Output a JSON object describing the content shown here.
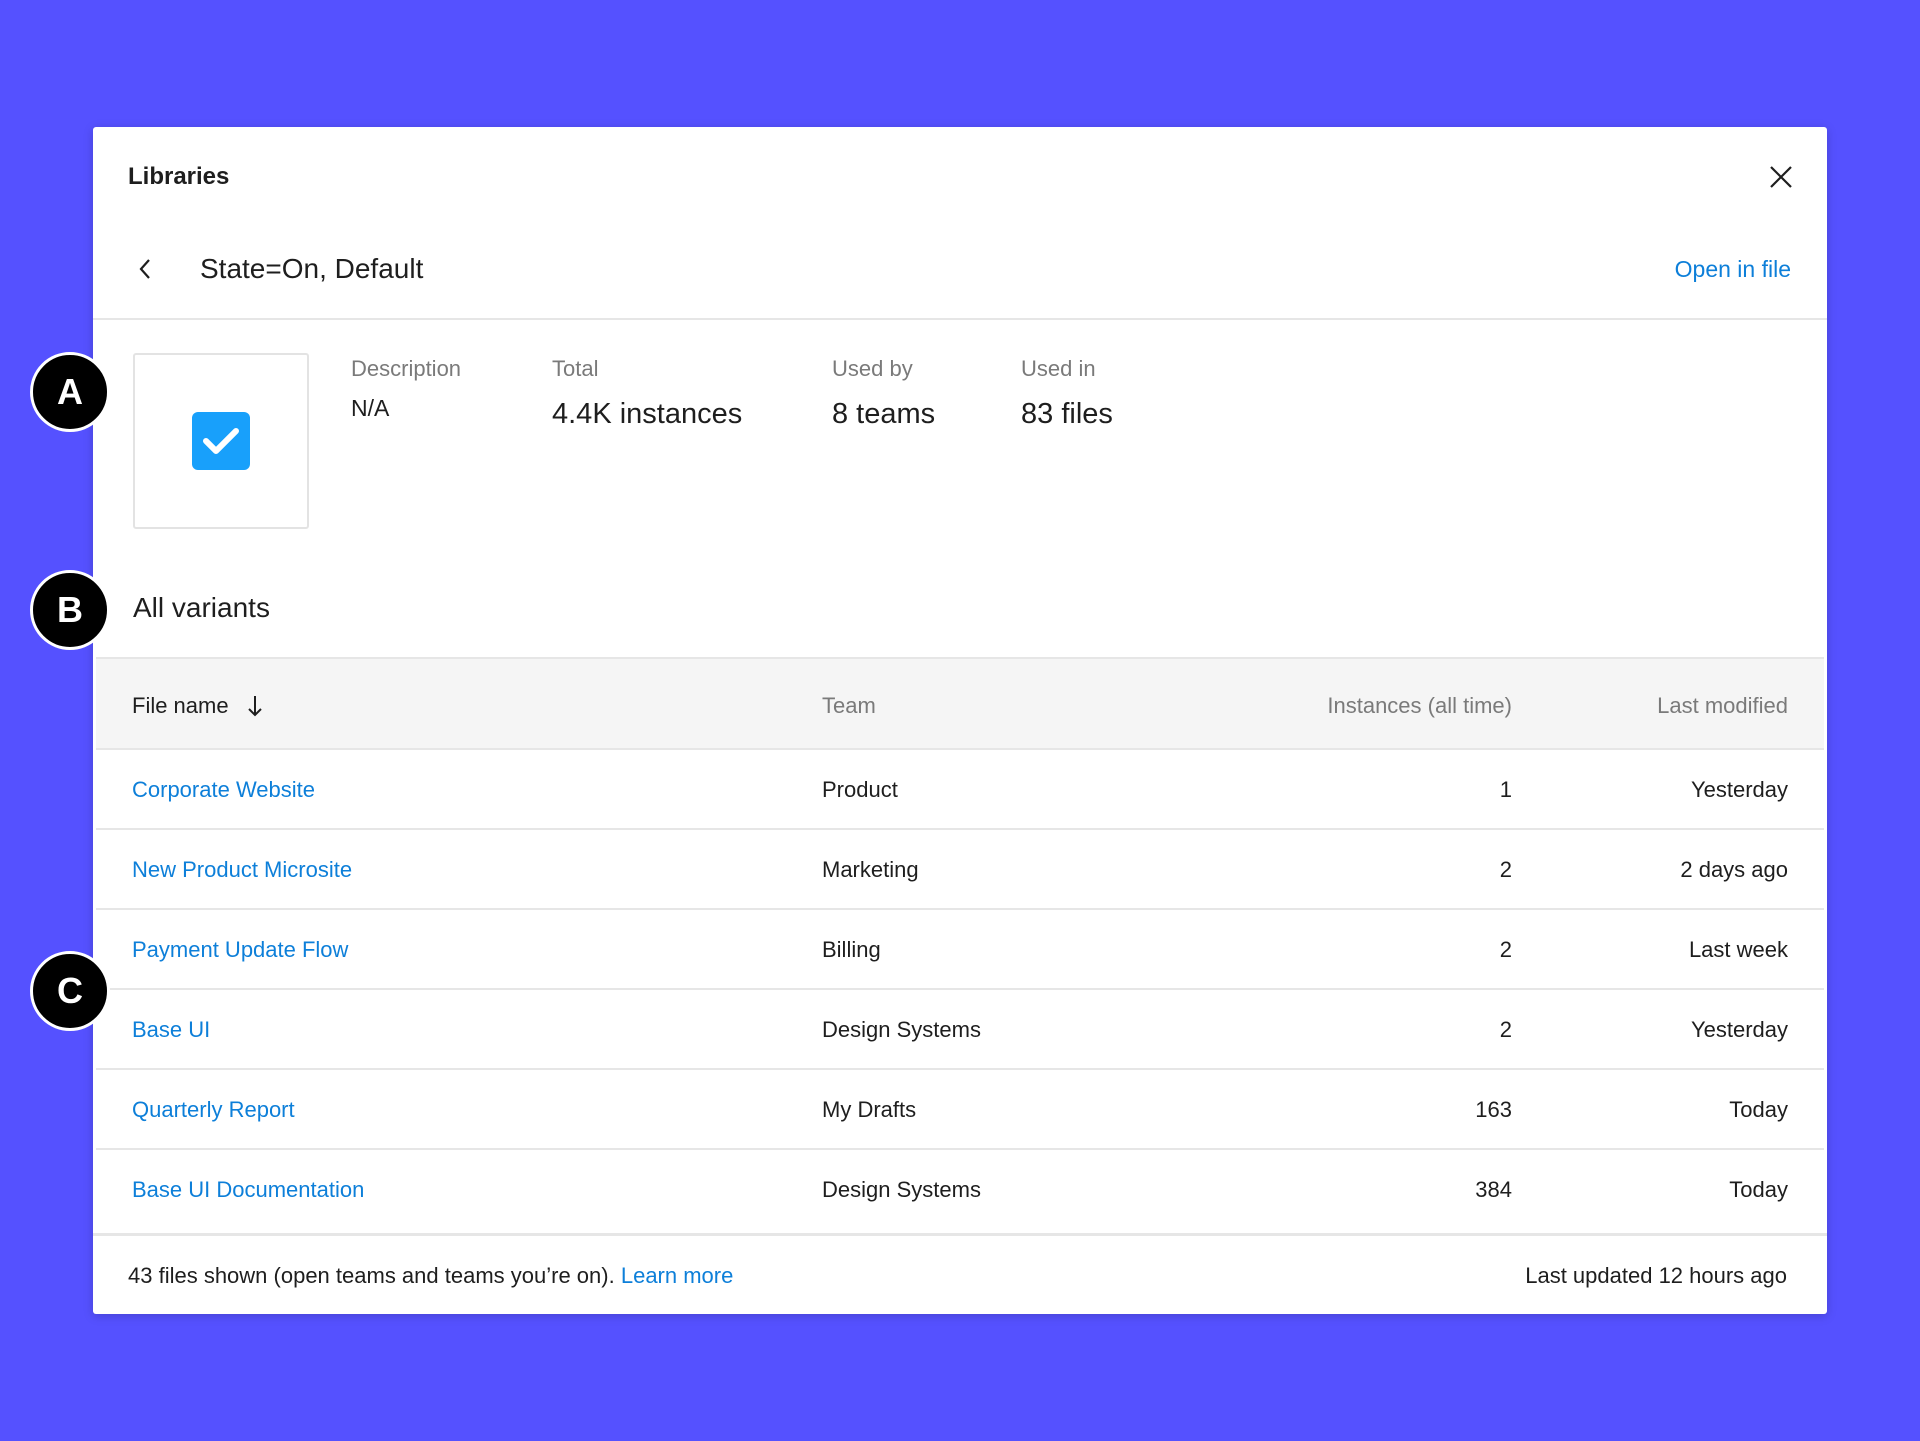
{
  "dialog": {
    "title": "Libraries",
    "close_icon": "close-icon"
  },
  "header": {
    "back_icon": "chevron-left-icon",
    "component_name": "State=On, Default",
    "open_in_file": "Open in file"
  },
  "summary": {
    "thumbnail_icon": "checkbox-checked-icon",
    "description": {
      "label": "Description",
      "value": "N/A"
    },
    "total": {
      "label": "Total",
      "value": "4.4K instances"
    },
    "used_by": {
      "label": "Used by",
      "value": "8 teams"
    },
    "used_in": {
      "label": "Used in",
      "value": "83 files"
    }
  },
  "variants": {
    "title": "All variants",
    "columns": {
      "file_name": "File name",
      "team": "Team",
      "instances": "Instances (all time)",
      "last_modified": "Last modified"
    },
    "sort_icon": "arrow-down-icon",
    "rows": [
      {
        "file": "Corporate Website",
        "team": "Product",
        "instances": "1",
        "modified": "Yesterday"
      },
      {
        "file": "New Product Microsite",
        "team": "Marketing",
        "instances": "2",
        "modified": "2 days ago"
      },
      {
        "file": "Payment Update Flow",
        "team": "Billing",
        "instances": "2",
        "modified": "Last week"
      },
      {
        "file": "Base UI",
        "team": "Design Systems",
        "instances": "2",
        "modified": "Yesterday"
      },
      {
        "file": "Quarterly Report",
        "team": "My Drafts",
        "instances": "163",
        "modified": "Today"
      },
      {
        "file": "Base UI Documentation",
        "team": "Design Systems",
        "instances": "384",
        "modified": "Today"
      }
    ]
  },
  "footer": {
    "files_shown": "43 files shown (open teams and teams you’re on).",
    "learn_more": "Learn more",
    "last_updated": "Last updated 12 hours ago"
  },
  "markers": {
    "a": "A",
    "b": "B",
    "c": "C"
  },
  "colors": {
    "background": "#5551ff",
    "link": "#0d7fd9",
    "checkbox": "#18a0fb"
  }
}
